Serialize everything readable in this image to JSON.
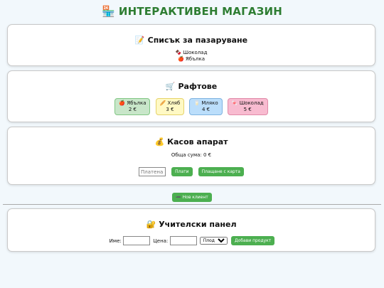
{
  "header": {
    "icon": "🏪",
    "title": "ИНТЕРАКТИВЕН МАГАЗИН"
  },
  "shopping_list": {
    "icon": "📝",
    "title": "Списък за пазаруване",
    "items": [
      {
        "icon": "🍫",
        "name": "Шоколад"
      },
      {
        "icon": "🍎",
        "name": "Ябълка"
      }
    ]
  },
  "shelves": {
    "icon": "🛒",
    "title": "Рафтове",
    "products": [
      {
        "icon": "🍎",
        "name": "Ябълка",
        "price": "2 €",
        "bg": "#c8e6c9",
        "border": "#81c784"
      },
      {
        "icon": "🥖",
        "name": "Хляб",
        "price": "3 €",
        "bg": "#fff9c4",
        "border": "#e6d36a"
      },
      {
        "icon": "🥛",
        "name": "Мляко",
        "price": "4 €",
        "bg": "#bbdefb",
        "border": "#7fb3e0"
      },
      {
        "icon": "🍬",
        "name": "Шоколад",
        "price": "5 €",
        "bg": "#f8bbd0",
        "border": "#e08aa8"
      }
    ]
  },
  "register": {
    "icon": "💰",
    "title": "Касов апарат",
    "total_label": "Обща сума: 0 €",
    "paid_placeholder": "Платена",
    "pay_button": "Плати",
    "card_button": "Плащане с карта"
  },
  "new_client": {
    "icon": "➖",
    "label": "Нов клиент"
  },
  "teacher": {
    "icon": "🔐",
    "title": "Учителски панел",
    "name_label": "Име:",
    "price_label": "Цена:",
    "category_selected": "Плод",
    "add_button": "Добави продукт"
  },
  "colors": {
    "accent": "#4caf50",
    "title": "#2e7d32",
    "background": "#f2f8fc"
  }
}
